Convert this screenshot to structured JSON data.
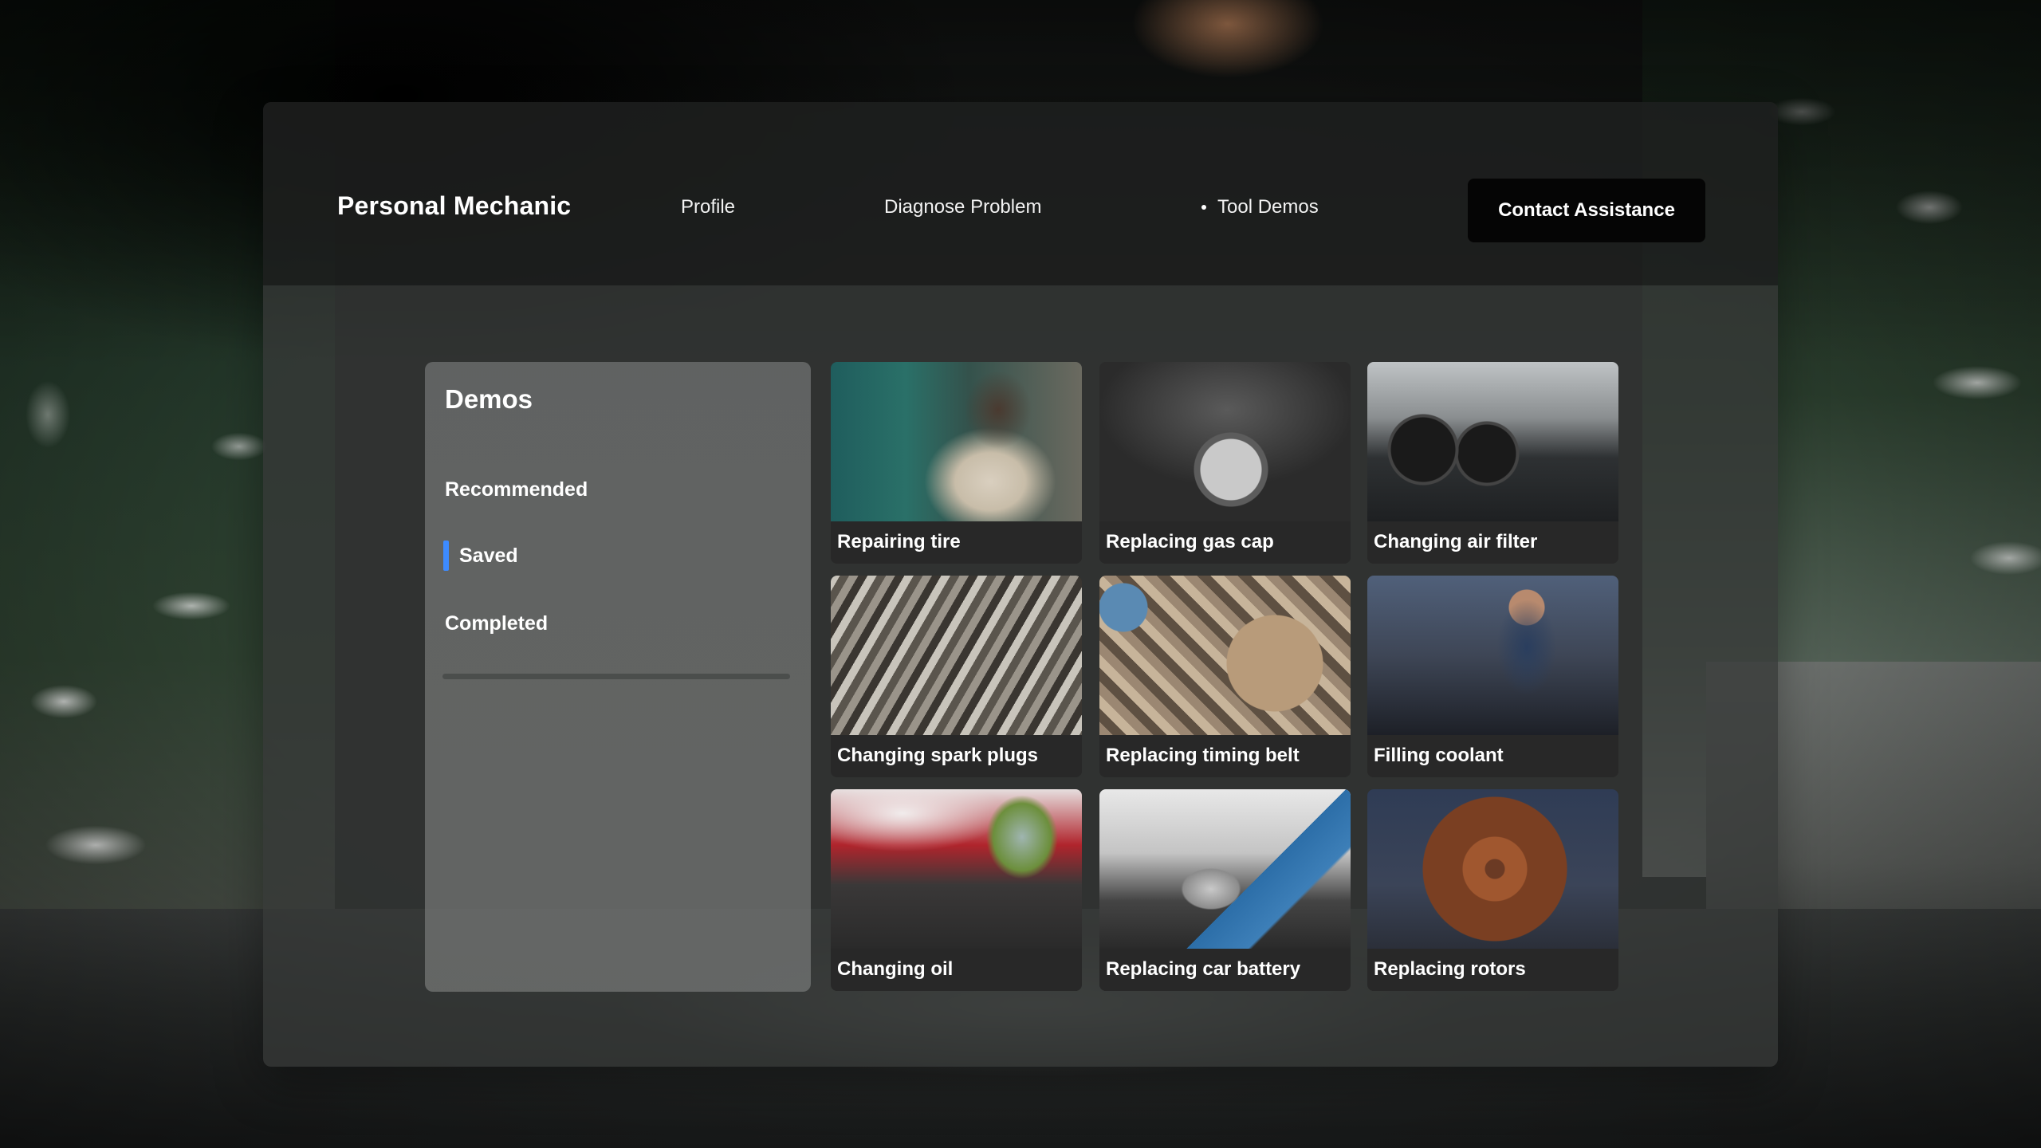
{
  "nav": {
    "brand": "Personal Mechanic",
    "links": [
      "Profile",
      "Diagnose Problem",
      "Tool Demos"
    ],
    "active_link_index": 2,
    "cta": "Contact Assistance"
  },
  "sidebar": {
    "title": "Demos",
    "items": [
      {
        "label": "Recommended",
        "active": false
      },
      {
        "label": "Saved",
        "active": true
      },
      {
        "label": "Completed",
        "active": false
      }
    ],
    "accent_color": "#3d8bff"
  },
  "demos": [
    {
      "label": "Repairing tire"
    },
    {
      "label": "Replacing gas cap"
    },
    {
      "label": "Changing air filter"
    },
    {
      "label": "Changing spark plugs"
    },
    {
      "label": "Replacing timing belt"
    },
    {
      "label": "Filling coolant"
    },
    {
      "label": "Changing oil"
    },
    {
      "label": "Replacing car battery"
    },
    {
      "label": "Replacing rotors"
    }
  ]
}
